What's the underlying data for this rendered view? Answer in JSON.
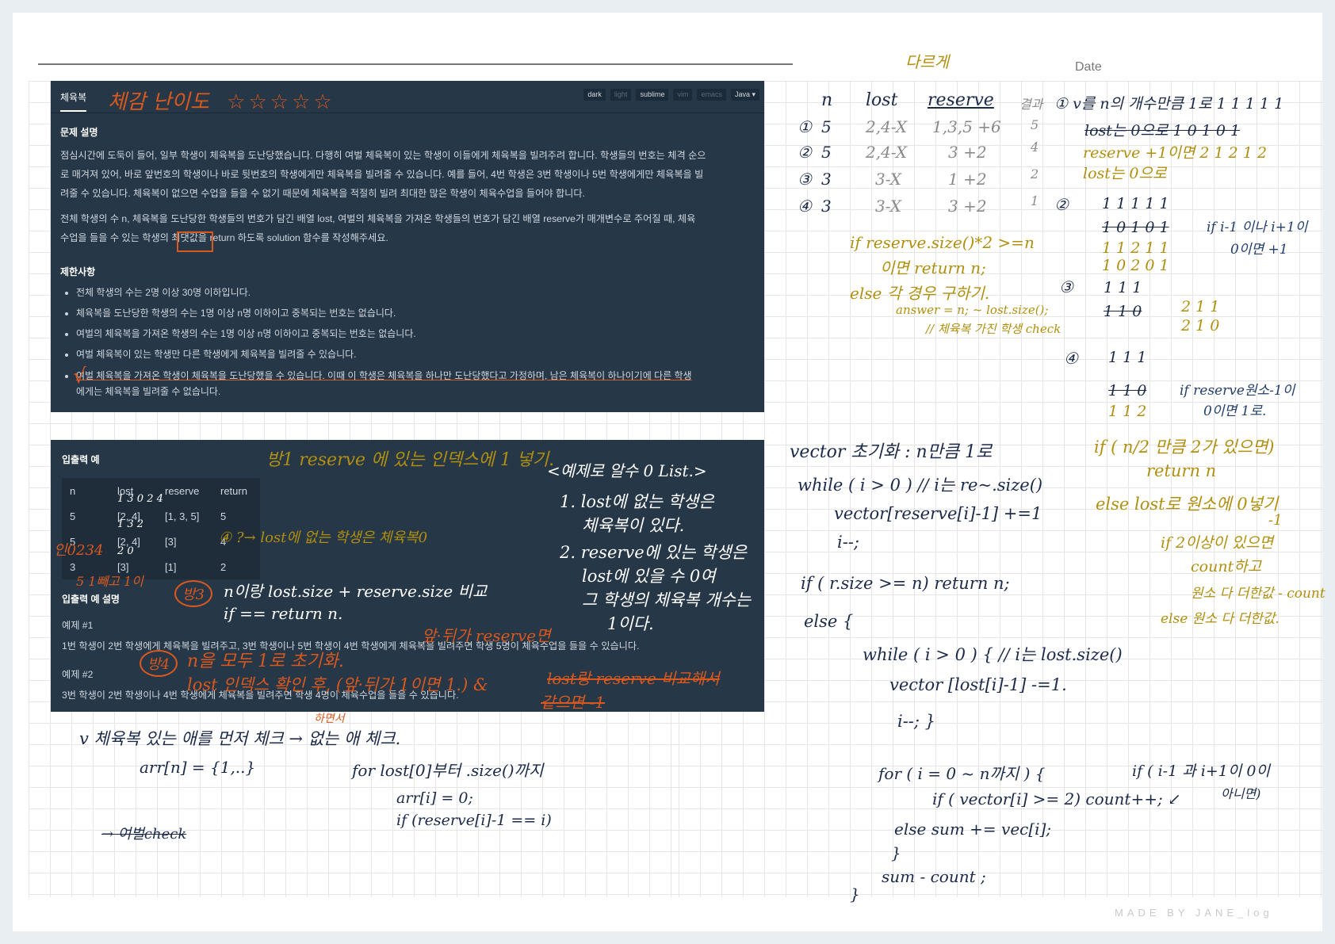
{
  "date_label": "Date",
  "watermark": "MADE BY JANE_log",
  "top_note": "다르게",
  "problem_panel": {
    "tab": "체육복",
    "settings": [
      "dark",
      "light",
      "sublime",
      "vim",
      "emacs",
      "Java ▾"
    ],
    "difficulty_note": "체감 난이도",
    "stars": "☆☆☆☆☆",
    "desc_heading": "문제 설명",
    "desc_p1_lines": [
      "점심시간에 도둑이 들어, 일부 학생이 체육복을 도난당했습니다. 다행히 여벌 체육복이 있는 학생이 이들에게 체육복을 빌려주려 합니다. 학생들의 번호는 체격 순으",
      "로 매겨져 있어, 바로 앞번호의 학생이나 바로 뒷번호의 학생에게만 체육복을 빌려줄 수 있습니다. 예를 들어, 4번 학생은 3번 학생이나 5번 학생에게만 체육복을 빌",
      "려줄 수 있습니다. 체육복이 없으면 수업을 들을 수 없기 때문에 체육복을 적절히 빌려 최대한 많은 학생이 체육수업을 들어야 합니다."
    ],
    "desc_p2_lines": [
      "전체 학생의 수 n, 체육복을 도난당한 학생들의 번호가 담긴 배열 lost, 여벌의 체육복을 가져온 학생들의 번호가 담긴 배열 reserve가 매개변수로 주어질 때, 체육",
      "수업을 들을 수 있는 학생의 최댓값을 return 하도록 solution 함수를 작성해주세요."
    ],
    "limits_heading": "제한사항",
    "limits": [
      "전체 학생의 수는 2명 이상 30명 이하입니다.",
      "체육복을 도난당한 학생의 수는 1명 이상 n명 이하이고 중복되는 번호는 없습니다.",
      "여벌의 체육복을 가져온 학생의 수는 1명 이상 n명 이하이고 중복되는 번호는 없습니다.",
      "여벌 체육복이 있는 학생만 다른 학생에게 체육복을 빌려줄 수 있습니다."
    ],
    "limit5_line1": "여벌 체육복을 가져온 학생이 체육복을 도난당했을 수 있습니다. 이때 이 학생은 체육복을 하나만 도난당했다고 가정하며, 남은 체육복이 하나이기에 다른 학생",
    "limit5_line2": "에게는 체육복을 빌려줄 수 없습니다.",
    "check_mark": "√"
  },
  "io_panel": {
    "heading": "입출력 예",
    "columns": [
      "n",
      "lost",
      "reserve",
      "return"
    ],
    "rows": [
      [
        "5",
        "[2, 4]",
        "[1, 3, 5]",
        "5"
      ],
      [
        "5",
        "[2, 4]",
        "[3]",
        "4"
      ],
      [
        "3",
        "[3]",
        "[1]",
        "2"
      ]
    ],
    "explain_heading": "입출력 예 설명",
    "ex1_title": "예제 #1",
    "ex1_text": "1번 학생이 2번 학생에게 체육복을 빌려주고, 3번 학생이나 5번 학생이 4번 학생에게 체육복을 빌려주면 학생 5명이 체육수업을 들을 수 있습니다.",
    "ex2_title": "예제 #2",
    "ex2_text": "3번 학생이 2번 학생이나 4번 학생에게 체육복을 빌려주면 학생 4명이 체육수업을 들을 수 있습니다."
  },
  "annotations": {
    "method1": "방1  reserve 에 있는 인덱스에 1 넣기.",
    "hints_title": "<예제로 알수 0 List.>",
    "hint1_line1": "1. lost에 없는 학생은",
    "hint1_line2": "체육복이 있다.",
    "hint2_line1": "2. reserve에 있는 학생은",
    "hint2_line2": "lost에 있을 수 0여",
    "hint2_line3": "그 학생의 체육복 개수는",
    "hint2_line4": "1이다.",
    "q4": "④ ?→ lost에 없는 학생은 체육복0",
    "idx_note1": "인0234",
    "idx_note2": "5 1빼고 1이",
    "row_marks1": "1 3   0 2 4",
    "row_marks2": "1 3   2",
    "row_marks3": "2   0",
    "method3_label": "방3",
    "method3_line1": "n이랑 lost.size + reserve.size 비교",
    "method3_line2": "if == return n.",
    "method4_label": "방4",
    "method4_line1": "n을 모두 1로 초기화.",
    "method4_line2": "lost 인덱스 확인 후, (앞·뒤가 1이면 1.) &",
    "method4_strike1": "lost랑 reserve 비교해서",
    "method4_strike2": "같으면 -1",
    "front_back": "앞·뒤가 reserve면",
    "hayeonseo": "하면서",
    "bottom_line1": "v 체육복 있는 애를 먼저 체크 → 없는 애 체크.",
    "bottom_arr": "arr[n] = {1,..}",
    "bottom_for": "for  lost[0]부터  .size()까지",
    "bottom_arr2": "arr[i] = 0;",
    "bottom_if": "if  (reserve[i]-1 == i)",
    "bottom_extra": "→ 여벌check",
    "table_header": [
      "n",
      "lost",
      "reserve",
      "결과"
    ],
    "table_rows": [
      [
        "①",
        "5",
        "2,4-X",
        "1,3,5 +6",
        "5"
      ],
      [
        "②",
        "5",
        "2,4-X",
        "3 +2",
        "4"
      ],
      [
        "③",
        "3",
        "3-X",
        "1 +2",
        "2"
      ],
      [
        "④",
        "3",
        "3-X",
        "3 +2",
        "1"
      ]
    ],
    "gold_if1": "if  reserve.size()*2 >=n",
    "gold_if2": "이면 return n;",
    "gold_else": "else 각 경우 구하기.",
    "gold_answer": "answer = n; ~ lost.size();",
    "gold_comment": "// 체육복 가진 학생 check",
    "case1_title": "① v를 n의 개수만큼 1로   1 1 1 1 1",
    "case1_l2": "lost는 0으로   1 0 1 0 1",
    "case1_l3": "reserve +1이면  2 1 2 1 2",
    "case1_l4": "lost는 0으로",
    "case2_num": "②",
    "case2_l1": "1 1 1 1 1",
    "case2_l2": "1 0 1 0 1",
    "case2_l3": "1 1 2 1 1",
    "case2_l4": "1 0 2 0 1",
    "case2_note1": "if  i-1 이나 i+1이",
    "case2_note2": "0이면 +1",
    "case3_num": "③",
    "case3_l1": "1 1 1",
    "case3_l2": "1 1 0",
    "case3_r1": "2 1 1",
    "case3_r2": "2 1 0",
    "case4_num": "④",
    "case4_l1": "1 1 1",
    "case4_l2": "1 1 0",
    "case4_l3": "1 1 2",
    "case4_note1": "if  reserve원소-1이",
    "case4_note2": "0이면 1로.",
    "vec_init": "vector 초기화 : n만큼 1로",
    "code1": "while ( i > 0 )  // i는 re~.size()",
    "code2": "vector[reserve[i]-1] +=1",
    "code3": "i--;",
    "code4": "if  ( r.size >= n)  return n;",
    "code5": "else {",
    "code6": "while ( i > 0 ) {  // i는 lost.size()",
    "code7": "vector [lost[i]-1] -=1.",
    "code8": "i--;  }",
    "code9": "for ( i = 0 ~ n까지 ) {",
    "code10": "if ( vector[i] >= 2)  count++; ↙",
    "code11": "else sum += vec[i];",
    "code12": "}",
    "code13": "sum - count ;",
    "code14": "}",
    "code_note1": "if ( i-1 과 i+1이 0이",
    "code_note2": "아니면)",
    "right_if1": "if ( n/2 만큼 2가 있으면)",
    "right_ret": "return n",
    "right_else": "else   lost로 원소에 0넣기",
    "right_minus": "-1",
    "right_if2": "if  2이상이 있으면",
    "right_count": "count하고",
    "right_sum": "원소 다 더한값 - count",
    "right_else2": "else  원소 다 더한값."
  }
}
